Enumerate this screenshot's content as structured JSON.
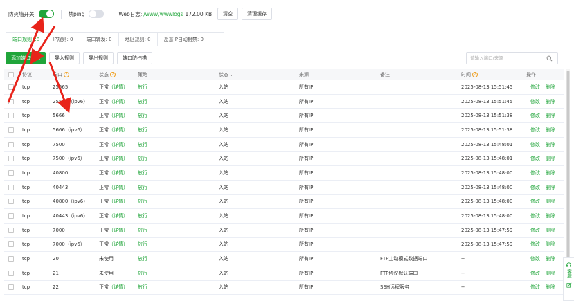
{
  "topbar": {
    "firewall_label": "防火墙开关",
    "firewall_on": true,
    "ping_label": "禁ping",
    "ping_on": false,
    "weblog_label": "Web日志:",
    "weblog_path": "/www/wwwlogs",
    "weblog_size": "172.00 KB",
    "clear_label": "清空",
    "clear_cache_label": "清理缓存"
  },
  "tabs": [
    {
      "label": "端口规则",
      "count": "28"
    },
    {
      "label": "IP规则",
      "count": "0"
    },
    {
      "label": "端口转发",
      "count": "0"
    },
    {
      "label": "地区规则",
      "count": "0"
    },
    {
      "label": "恶意IP自动封禁",
      "count": "0"
    }
  ],
  "toolbar": {
    "add_label": "添加端口规则",
    "import_label": "导入规则",
    "export_label": "导出规则",
    "scan_label": "端口防扫描"
  },
  "search": {
    "placeholder": "请输入端口/来源"
  },
  "table": {
    "headers": {
      "protocol": "协议",
      "port": "端口",
      "status": "状态",
      "policy": "策略",
      "direction": "状态",
      "source": "来源",
      "note": "备注",
      "time": "时间",
      "ops": "操作"
    },
    "rows": [
      {
        "protocol": "tcp",
        "port": "25565",
        "status": "正常",
        "detail": "（详情）",
        "policy": "放行",
        "direction": "入站",
        "source": "所有IP",
        "note": "",
        "time": "2025-08-13 15:51:45",
        "edit": "修改",
        "del": "删除"
      },
      {
        "protocol": "tcp",
        "port": "25565（ipv6）",
        "status": "正常",
        "detail": "（详情）",
        "policy": "放行",
        "direction": "入站",
        "source": "所有IP",
        "note": "",
        "time": "2025-08-13 15:51:45",
        "edit": "修改",
        "del": "删除"
      },
      {
        "protocol": "tcp",
        "port": "5666",
        "status": "正常",
        "detail": "（详情）",
        "policy": "放行",
        "direction": "入站",
        "source": "所有IP",
        "note": "",
        "time": "2025-08-13 15:51:38",
        "edit": "修改",
        "del": "删除"
      },
      {
        "protocol": "tcp",
        "port": "5666（ipv6）",
        "status": "正常",
        "detail": "（详情）",
        "policy": "放行",
        "direction": "入站",
        "source": "所有IP",
        "note": "",
        "time": "2025-08-13 15:51:38",
        "edit": "修改",
        "del": "删除"
      },
      {
        "protocol": "tcp",
        "port": "7500",
        "status": "正常",
        "detail": "（详情）",
        "policy": "放行",
        "direction": "入站",
        "source": "所有IP",
        "note": "",
        "time": "2025-08-13 15:48:01",
        "edit": "修改",
        "del": "删除"
      },
      {
        "protocol": "tcp",
        "port": "7500（ipv6）",
        "status": "正常",
        "detail": "（详情）",
        "policy": "放行",
        "direction": "入站",
        "source": "所有IP",
        "note": "",
        "time": "2025-08-13 15:48:01",
        "edit": "修改",
        "del": "删除"
      },
      {
        "protocol": "tcp",
        "port": "40800",
        "status": "正常",
        "detail": "（详情）",
        "policy": "放行",
        "direction": "入站",
        "source": "所有IP",
        "note": "",
        "time": "2025-08-13 15:48:00",
        "edit": "修改",
        "del": "删除"
      },
      {
        "protocol": "tcp",
        "port": "40443",
        "status": "正常",
        "detail": "（详情）",
        "policy": "放行",
        "direction": "入站",
        "source": "所有IP",
        "note": "",
        "time": "2025-08-13 15:48:00",
        "edit": "修改",
        "del": "删除"
      },
      {
        "protocol": "tcp",
        "port": "40800（ipv6）",
        "status": "正常",
        "detail": "（详情）",
        "policy": "放行",
        "direction": "入站",
        "source": "所有IP",
        "note": "",
        "time": "2025-08-13 15:48:00",
        "edit": "修改",
        "del": "删除"
      },
      {
        "protocol": "tcp",
        "port": "40443（ipv6）",
        "status": "正常",
        "detail": "（详情）",
        "policy": "放行",
        "direction": "入站",
        "source": "所有IP",
        "note": "",
        "time": "2025-08-13 15:48:00",
        "edit": "修改",
        "del": "删除"
      },
      {
        "protocol": "tcp",
        "port": "7000",
        "status": "正常",
        "detail": "（详情）",
        "policy": "放行",
        "direction": "入站",
        "source": "所有IP",
        "note": "",
        "time": "2025-08-13 15:47:59",
        "edit": "修改",
        "del": "删除"
      },
      {
        "protocol": "tcp",
        "port": "7000（ipv6）",
        "status": "正常",
        "detail": "（详情）",
        "policy": "放行",
        "direction": "入站",
        "source": "所有IP",
        "note": "",
        "time": "2025-08-13 15:47:59",
        "edit": "修改",
        "del": "删除"
      },
      {
        "protocol": "tcp",
        "port": "20",
        "status": "未使用",
        "detail": "",
        "policy": "放行",
        "direction": "入站",
        "source": "所有IP",
        "note": "FTP主动模式数据端口",
        "time": "--",
        "edit": "修改",
        "del": "删除"
      },
      {
        "protocol": "tcp",
        "port": "21",
        "status": "未使用",
        "detail": "",
        "policy": "放行",
        "direction": "入站",
        "source": "所有IP",
        "note": "FTP协议默认端口",
        "time": "--",
        "edit": "修改",
        "del": "删除"
      },
      {
        "protocol": "tcp",
        "port": "22",
        "status": "正常",
        "detail": "（详情）",
        "policy": "放行",
        "direction": "入站",
        "source": "所有IP",
        "note": "SSH远程服务",
        "time": "--",
        "edit": "修改",
        "del": "删除"
      }
    ]
  },
  "side": {
    "service_label": "客服"
  },
  "colors": {
    "accent": "#20a53a",
    "annotation": "#e8231a",
    "warning": "#f0a020"
  }
}
